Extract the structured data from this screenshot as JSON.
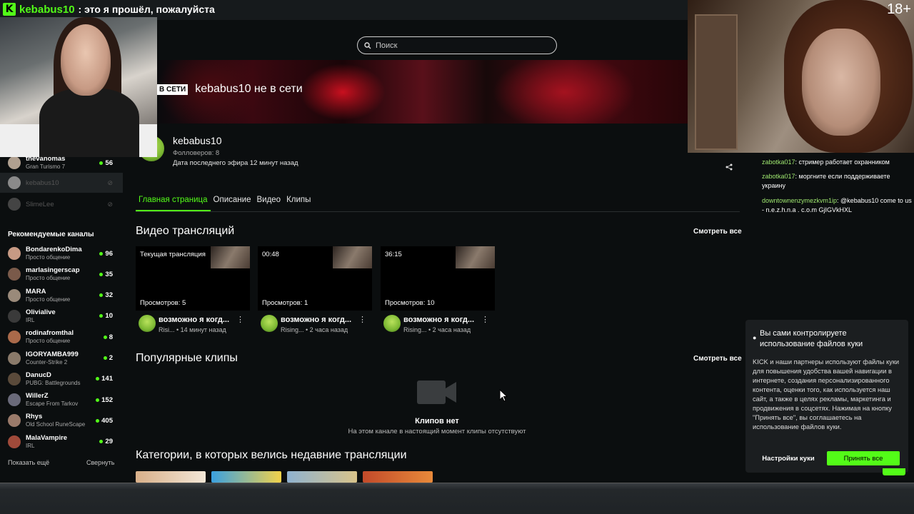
{
  "overlay": {
    "logo_letter": "K",
    "streamer_name": "kebabus10",
    "message": ": это я прошёл, пожалуйста",
    "age_rating": "18+"
  },
  "search": {
    "placeholder": "Поиск"
  },
  "banner": {
    "status_badge": "В СЕТИ",
    "offline_text": "kebabus10 не в сети"
  },
  "channel": {
    "name": "kebabus10",
    "followers": "Фолловеров: 8",
    "last_stream": "Дата последнего эфира 12 минут назад"
  },
  "sidebar": {
    "following": [
      {
        "name": "thevanomas",
        "sub": "Gran Turismo 7",
        "count": "56",
        "online": true
      },
      {
        "name": "kebabus10",
        "sub": "",
        "count": "",
        "online": false,
        "active": true
      },
      {
        "name": "SlimeLee",
        "sub": "",
        "count": "",
        "online": false
      }
    ],
    "recommended_title": "Рекомендуемые каналы",
    "recommended": [
      {
        "name": "BondarenkoDima",
        "sub": "Просто общение",
        "count": "96"
      },
      {
        "name": "marlasingerscap",
        "sub": "Просто общение",
        "count": "35"
      },
      {
        "name": "MARA",
        "sub": "Просто общение",
        "count": "32"
      },
      {
        "name": "Olivialive",
        "sub": "IRL",
        "count": "10"
      },
      {
        "name": "rodinafromthal",
        "sub": "Просто общение",
        "count": "8"
      },
      {
        "name": "IGORYAMBA999",
        "sub": "Counter-Strike 2",
        "count": "2"
      },
      {
        "name": "DanucD",
        "sub": "PUBG: Battlegrounds",
        "count": "141"
      },
      {
        "name": "WillerZ",
        "sub": "Escape From Tarkov",
        "count": "152"
      },
      {
        "name": "Rhys",
        "sub": "Old School RuneScape",
        "count": "405"
      },
      {
        "name": "MalaVampire",
        "sub": "IRL",
        "count": "29"
      }
    ],
    "show_more": "Показать ещё",
    "collapse": "Свернуть"
  },
  "tabs": [
    "Главная страница",
    "Описание",
    "Видео",
    "Клипы"
  ],
  "videos_section": {
    "title": "Видео трансляций",
    "see_all": "Смотреть все",
    "items": [
      {
        "top": "Текущая трансляция",
        "views": "Просмотров: 5",
        "title": "возможно я когд...",
        "sub": "Risi... • 14 минут назад"
      },
      {
        "top": "00:48",
        "views": "Просмотров: 1",
        "title": "возможно я когд...",
        "sub": "Rising... • 2 часа назад"
      },
      {
        "top": "36:15",
        "views": "Просмотров: 10",
        "title": "возможно я когд...",
        "sub": "Rising... • 2 часа назад"
      }
    ]
  },
  "clips_section": {
    "title": "Популярные клипы",
    "see_all": "Смотреть все",
    "empty_title": "Клипов нет",
    "empty_sub": "На этом канале в настоящий момент клипы отсутствуют"
  },
  "categories_section": {
    "title": "Категории, в которых велись недавние трансляции"
  },
  "chat": [
    {
      "user": "zabotka017",
      "text": ": стример работает охранником"
    },
    {
      "user": "zabotka017",
      "text": ": моргните если поддерживаете украину"
    },
    {
      "user": "downtownenzymezkvm1ip",
      "text": ": @kebabus10 come to us - n.e.z.h.n.a . c.o.m GjIGVkHXL"
    }
  ],
  "cookie": {
    "title": "Вы сами контролируете использование файлов куки",
    "body": "KICK и наши партнеры используют файлы куки для повышения удобства вашей навигации в интернете, создания персонализированного контента, оценки того, как используется наш сайт, а также в целях рекламы, маркетинга и продвижения в соцсетях. Нажимая на кнопку \"Принять все\", вы соглашаетесь на использование файлов куки.",
    "settings_label": "Настройки куки",
    "accept_label": "Принять все"
  },
  "colors": {
    "accent": "#53fc18",
    "background": "#0b0e0f"
  }
}
